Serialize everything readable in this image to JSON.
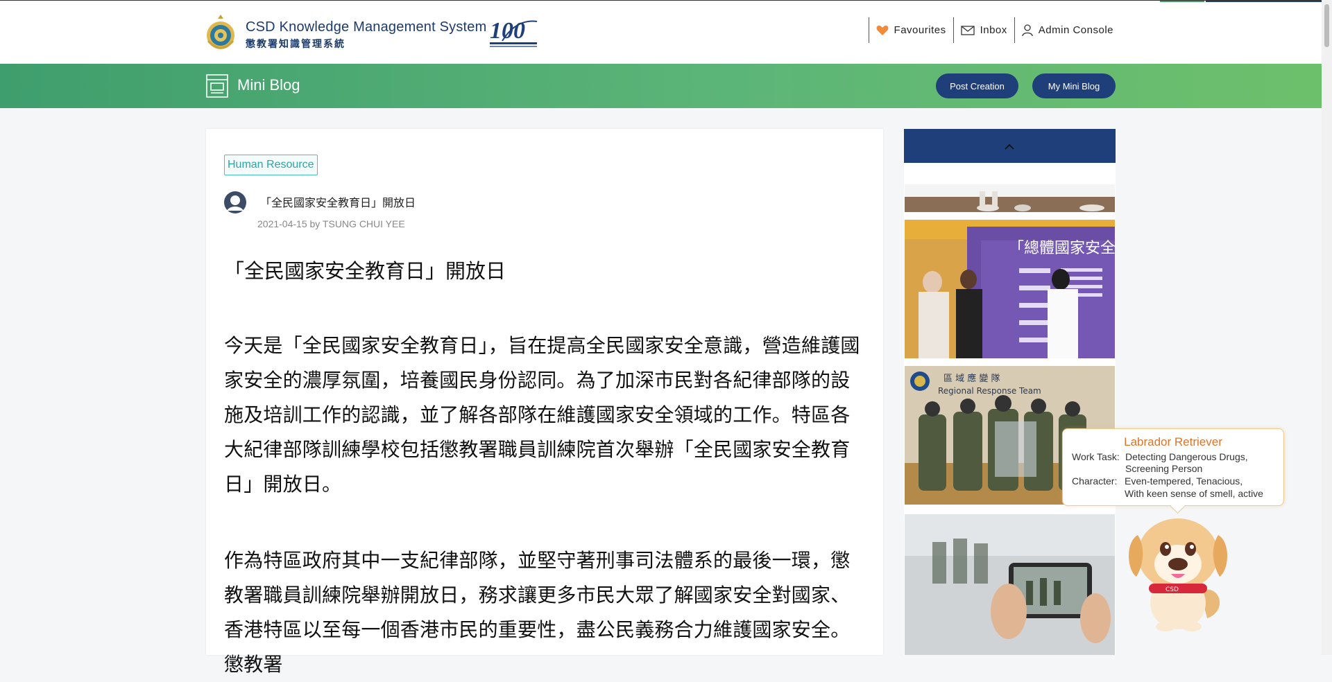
{
  "header": {
    "system_name": "CSD Knowledge Management System",
    "system_name_cn": "懲教署知識管理系統",
    "nav": {
      "favourites": "Favourites",
      "inbox": "Inbox",
      "admin": "Admin Console"
    }
  },
  "subheader": {
    "title": "Mini Blog",
    "post_creation": "Post Creation",
    "my_mini_blog": "My Mini Blog"
  },
  "post": {
    "category": "Human Resource",
    "title": "「全民國家安全教育日」開放日",
    "meta": "2021-04-15 by TSUNG CHUI YEE",
    "heading": "「全民國家安全教育日」開放日",
    "paragraph1": "今天是「全民國家安全教育日」，旨在提高全民國家安全意識，營造維護國家安全的濃厚氛圍，培養國民身份認同。為了加深市民對各紀律部隊的設施及培訓工作的認識，並了解各部隊在維護國家安全領域的工作。特區各大紀律部隊訓練學校包括懲教署職員訓練院首次舉辦「全民國家安全教育日」開放日。",
    "paragraph2": "作為特區政府其中一支紀律部隊，並堅守著刑事司法體系的最後一環，懲教署職員訓練院舉辦開放日，務求讓更多市民大眾了解國家安全對國家、香港特區以至每一個香港市民的重要性，盡公民義務合力維護國家安全。懲教署"
  },
  "sidebar": {
    "photos": [
      "photo-exhibit-board",
      "photo-regional-response-team",
      "photo-phone-capture"
    ],
    "banner_text_1": "「總體國家安全觀」",
    "banner_text_2": "區 域 應 變 隊",
    "banner_text_3": "Regional Response Team"
  },
  "mascot": {
    "name": "Labrador Retriever",
    "task_label": "Work Task:",
    "task_1": "Detecting Dangerous Drugs,",
    "task_2": "Screening Person",
    "character_label": "Character:",
    "character_1": "Even-tempered, Tenacious,",
    "character_2": "With keen sense of smell, active",
    "collar": "CSD"
  },
  "colors": {
    "navy": "#1e3f7a",
    "green": "#5cb578",
    "tag": "#2aa6a6",
    "mascot_orange": "#d9742a"
  }
}
